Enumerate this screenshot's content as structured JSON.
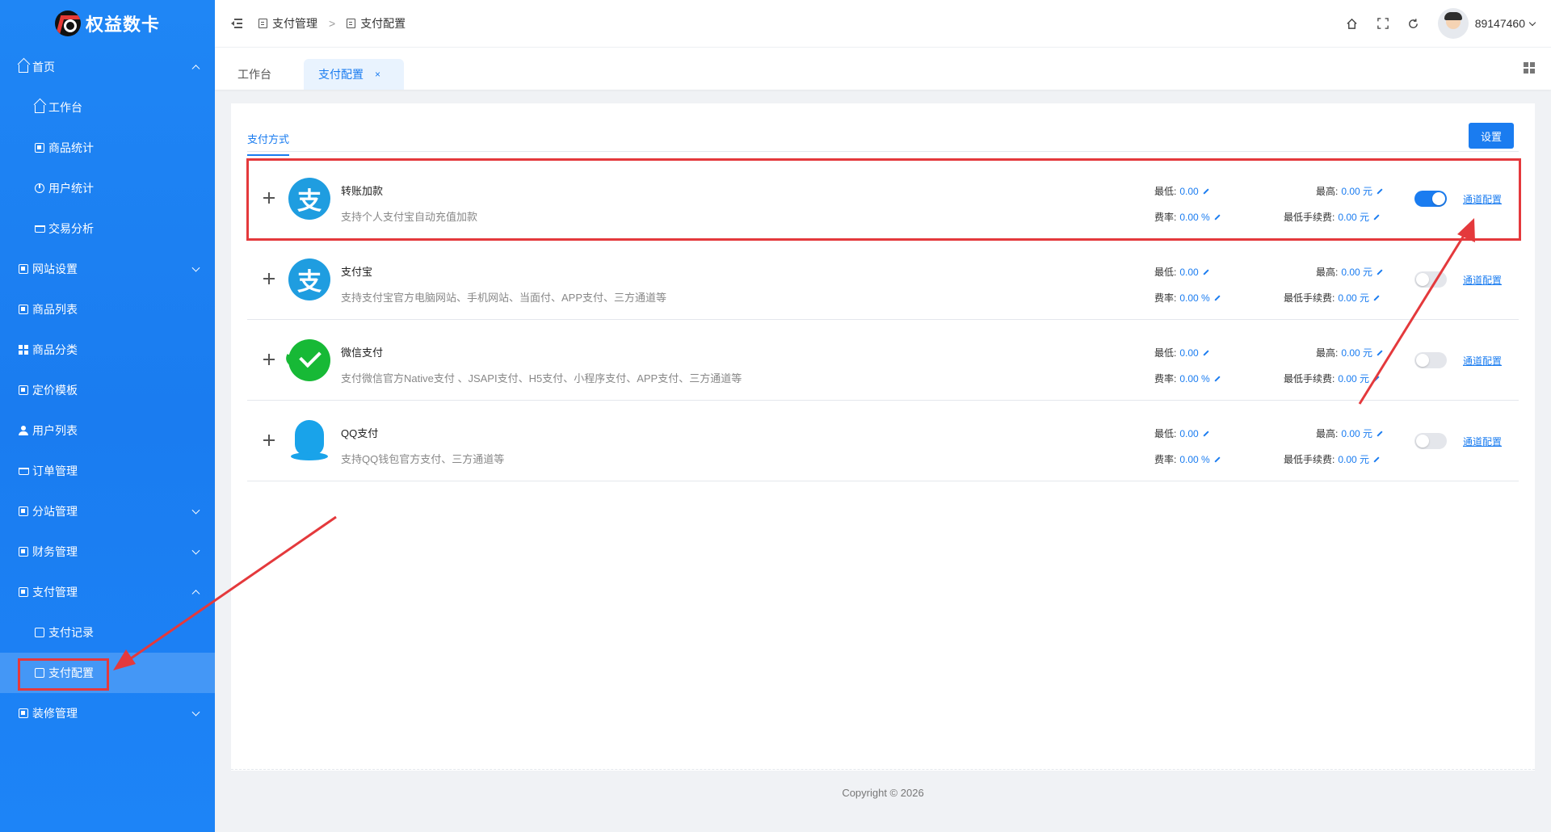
{
  "app": {
    "title": "权益数卡"
  },
  "colors": {
    "primary": "#1a7cf0",
    "annotation": "#e4393c",
    "alipay": "#1f9de0",
    "wechat": "#17b936",
    "qq": "#19a3ea"
  },
  "sidebar": {
    "items": [
      {
        "label": "首页",
        "icon": "home-icon",
        "expandable": true,
        "expanded": true
      },
      {
        "label": "工作台",
        "icon": "home-icon",
        "sub": true
      },
      {
        "label": "商品统计",
        "icon": "bank-icon",
        "sub": true
      },
      {
        "label": "用户统计",
        "icon": "pie-chart-icon",
        "sub": true
      },
      {
        "label": "交易分析",
        "icon": "cart-icon",
        "sub": true
      },
      {
        "label": "网站设置",
        "icon": "settings-icon",
        "expandable": true,
        "expanded": false
      },
      {
        "label": "商品列表",
        "icon": "list-icon"
      },
      {
        "label": "商品分类",
        "icon": "grid-icon"
      },
      {
        "label": "定价模板",
        "icon": "template-icon"
      },
      {
        "label": "用户列表",
        "icon": "user-icon"
      },
      {
        "label": "订单管理",
        "icon": "cart-icon"
      },
      {
        "label": "分站管理",
        "icon": "store-icon",
        "expandable": true,
        "expanded": false
      },
      {
        "label": "财务管理",
        "icon": "finance-icon",
        "expandable": true,
        "expanded": false
      },
      {
        "label": "支付管理",
        "icon": "payment-icon",
        "expandable": true,
        "expanded": true
      },
      {
        "label": "支付记录",
        "icon": "doc-icon",
        "sub": true
      },
      {
        "label": "支付配置",
        "icon": "doc-icon",
        "sub": true,
        "active": true
      },
      {
        "label": "装修管理",
        "icon": "decorate-icon",
        "expandable": true,
        "expanded": false
      }
    ]
  },
  "header": {
    "breadcrumb": [
      "支付管理",
      "支付配置"
    ],
    "separator": ">",
    "user": "89147460"
  },
  "tabs": [
    {
      "label": "工作台"
    },
    {
      "label": "支付配置",
      "active": true,
      "close": "×"
    }
  ],
  "panel": {
    "tab_label": "支付方式",
    "settings_button": "设置",
    "labels": {
      "min": "最低:",
      "max": "最高:",
      "rate": "费率:",
      "min_fee": "最低手续费:",
      "channel_config": "通道配置"
    },
    "methods": [
      {
        "name": "转账加款",
        "desc": "支持个人支付宝自动充值加款",
        "logo": "alipay-logo",
        "min": "0.00",
        "max": "0.00 元",
        "rate": "0.00 %",
        "min_fee": "0.00 元",
        "enabled": true
      },
      {
        "name": "支付宝",
        "desc": "支持支付宝官方电脑网站、手机网站、当面付、APP支付、三方通道等",
        "logo": "alipay-logo",
        "min": "0.00",
        "max": "0.00 元",
        "rate": "0.00 %",
        "min_fee": "0.00 元",
        "enabled": false
      },
      {
        "name": "微信支付",
        "desc": "支付微信官方Native支付 、JSAPI支付、H5支付、小程序支付、APP支付、三方通道等",
        "logo": "wechat-logo",
        "min": "0.00",
        "max": "0.00 元",
        "rate": "0.00 %",
        "min_fee": "0.00 元",
        "enabled": false
      },
      {
        "name": "QQ支付",
        "desc": "支持QQ钱包官方支付、三方通道等",
        "logo": "qq-logo",
        "min": "0.00",
        "max": "0.00 元",
        "rate": "0.00 %",
        "min_fee": "0.00 元",
        "enabled": false
      }
    ]
  },
  "footer": {
    "copyright": "Copyright © 2026"
  }
}
